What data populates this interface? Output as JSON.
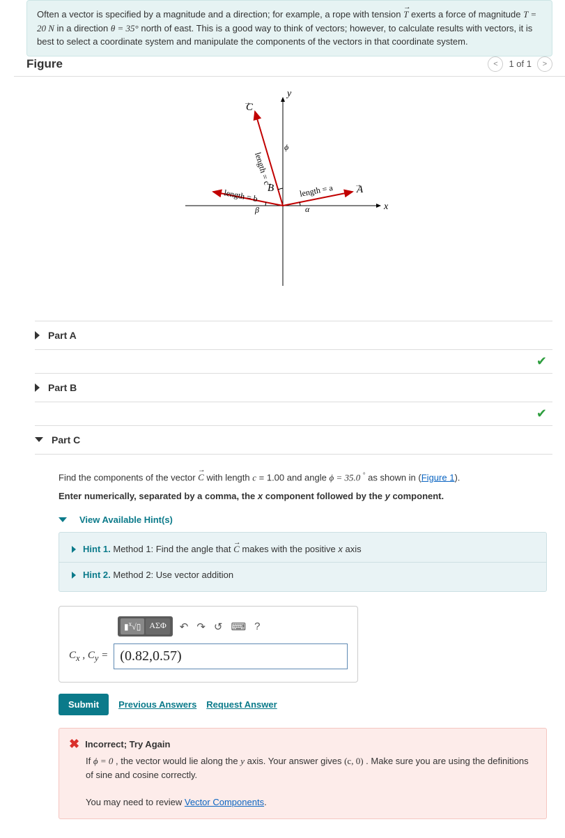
{
  "intro": {
    "pre": "Often a vector is specified by a magnitude and a direction; for example, a rope with tension ",
    "vec": "T",
    "mid1": " exerts a force of magnitude ",
    "eq1": "T = 20 N",
    "mid2": " in a direction ",
    "eq2": "θ = 35°",
    "mid3": " north of east. This is a good way to think of vectors; however, to calculate results with vectors, it is best to select a coordinate system and manipulate the components of the vectors in that coordinate system."
  },
  "figure": {
    "title": "Figure",
    "pager": "1 of 1"
  },
  "parts": {
    "a": {
      "label": "Part A"
    },
    "b": {
      "label": "Part B"
    },
    "c": {
      "label": "Part C"
    }
  },
  "partC": {
    "prompt_pre": "Find the components of the vector ",
    "prompt_vec": "C",
    "prompt_mid1": " with length ",
    "prompt_eq1": "c",
    "prompt_mid2": " = 1.00 and angle ",
    "prompt_eq2": "ϕ = 35.0",
    "prompt_deg": "°",
    "prompt_mid3": " as shown in (",
    "prompt_link": "Figure 1",
    "prompt_post": ").",
    "instr2_a": "Enter numerically, separated by a comma, the ",
    "instr2_x": "x",
    "instr2_b": " component followed by the ",
    "instr2_y": "y",
    "instr2_c": " component.",
    "hints_toggle": "View Available Hint(s)",
    "hint1_label": "Hint 1.",
    "hint1_text_a": " Method 1:  Find the angle that ",
    "hint1_vec": "C",
    "hint1_text_b": " makes with the positive ",
    "hint1_x": "x",
    "hint1_text_c": " axis",
    "hint2_label": "Hint 2.",
    "hint2_text": " Method 2: Use vector addition",
    "toolbar": {
      "eq": "x√",
      "greek": "ΑΣΦ",
      "undo": "↶",
      "redo": "↷",
      "reset": "↺",
      "kbd": "⌨",
      "help": "?"
    },
    "answer_label": "Cₓ , C_y  =",
    "answer_value": "(0.82,0.57)",
    "submit": "Submit",
    "prev_answers": "Previous Answers",
    "request_answer": "Request Answer"
  },
  "feedback": {
    "head": "Incorrect; Try Again",
    "line1_a": "If ",
    "line1_eq": "ϕ = 0",
    "line1_b": ", the vector would lie along the ",
    "line1_y": "y",
    "line1_c": " axis. Your answer gives ",
    "line1_ans": "(c, 0)",
    "line1_d": ". Make sure you are using the definitions of sine and cosine correctly.",
    "line2_a": "You may need to review ",
    "line2_link": "Vector Components",
    "line2_b": "."
  },
  "chart_data": {
    "type": "diagram",
    "title": "Three vectors from origin in xy-plane",
    "axes": {
      "x_label": "x",
      "y_label": "y"
    },
    "vectors": [
      {
        "name": "A",
        "length_label": "a",
        "angle_label": "α",
        "direction": "above +x axis, small angle"
      },
      {
        "name": "B",
        "length_label": "b",
        "angle_label": "β",
        "direction": "above −x axis, small angle"
      },
      {
        "name": "C",
        "length_label": "c",
        "angle_label": "ϕ",
        "direction": "left of +y axis, small angle"
      }
    ]
  }
}
